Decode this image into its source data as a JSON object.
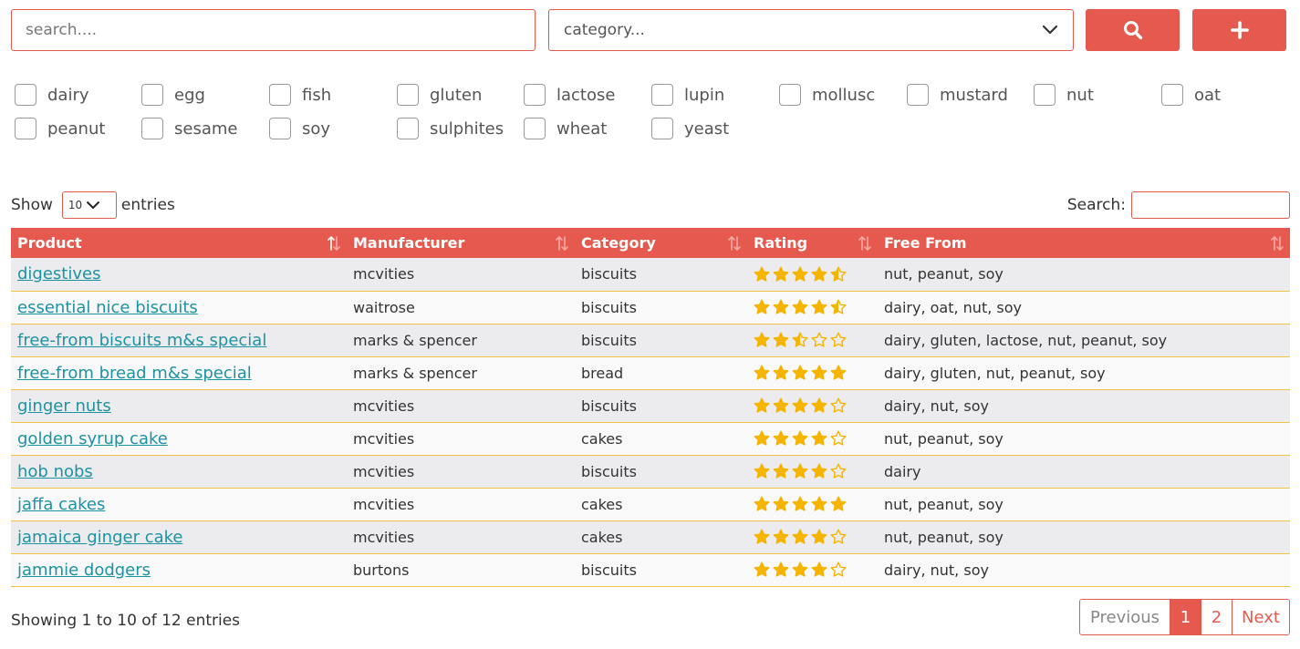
{
  "colors": {
    "accent": "#e5594e",
    "link": "#1c93a3",
    "star": "#f5b400",
    "row_border": "#f0c24a"
  },
  "search": {
    "placeholder": "search...."
  },
  "category": {
    "selected": "category..."
  },
  "buttons": {
    "search_icon": "search-icon",
    "add_icon": "plus-icon"
  },
  "allergens": [
    "dairy",
    "egg",
    "fish",
    "gluten",
    "lactose",
    "lupin",
    "mollusc",
    "mustard",
    "nut",
    "oat",
    "peanut",
    "sesame",
    "soy",
    "sulphites",
    "wheat",
    "yeast"
  ],
  "table_controls": {
    "show_label": "Show",
    "length_value": "10",
    "entries_label": "entries",
    "search_label": "Search:"
  },
  "columns": [
    "Product",
    "Manufacturer",
    "Category",
    "Rating",
    "Free From"
  ],
  "rows": [
    {
      "product": "digestives",
      "manufacturer": "mcvities",
      "category": "biscuits",
      "rating": 4.5,
      "free_from": "nut, peanut, soy"
    },
    {
      "product": "essential nice biscuits",
      "manufacturer": "waitrose",
      "category": "biscuits",
      "rating": 4.5,
      "free_from": "dairy, oat, nut, soy"
    },
    {
      "product": "free-from biscuits m&s special",
      "manufacturer": "marks & spencer",
      "category": "biscuits",
      "rating": 2.5,
      "free_from": "dairy, gluten, lactose, nut, peanut, soy"
    },
    {
      "product": "free-from bread m&s special",
      "manufacturer": "marks & spencer",
      "category": "bread",
      "rating": 5,
      "free_from": "dairy, gluten, nut, peanut, soy"
    },
    {
      "product": "ginger nuts",
      "manufacturer": "mcvities",
      "category": "biscuits",
      "rating": 4,
      "free_from": "dairy, nut, soy"
    },
    {
      "product": "golden syrup cake",
      "manufacturer": "mcvities",
      "category": "cakes",
      "rating": 4,
      "free_from": "nut, peanut, soy"
    },
    {
      "product": "hob nobs",
      "manufacturer": "mcvities",
      "category": "biscuits",
      "rating": 4,
      "free_from": "dairy"
    },
    {
      "product": "jaffa cakes",
      "manufacturer": "mcvities",
      "category": "cakes",
      "rating": 5,
      "free_from": "nut, peanut, soy"
    },
    {
      "product": "jamaica ginger cake",
      "manufacturer": "mcvities",
      "category": "cakes",
      "rating": 4,
      "free_from": "nut, peanut, soy"
    },
    {
      "product": "jammie dodgers",
      "manufacturer": "burtons",
      "category": "biscuits",
      "rating": 4,
      "free_from": "dairy, nut, soy"
    }
  ],
  "footer": {
    "info": "Showing 1 to 10 of 12 entries",
    "previous": "Previous",
    "pages": [
      "1",
      "2"
    ],
    "next": "Next"
  }
}
